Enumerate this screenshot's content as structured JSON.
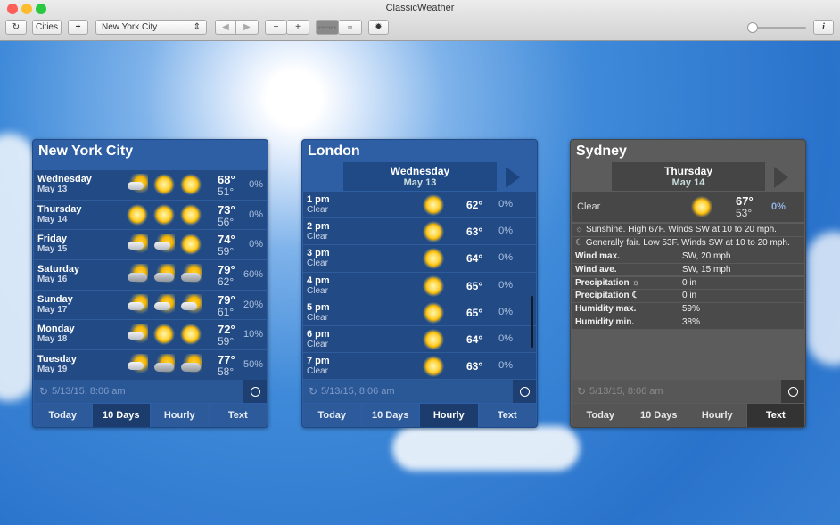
{
  "window": {
    "title": "ClassicWeather"
  },
  "toolbar": {
    "refresh_icon": "↻",
    "cities": "Cities",
    "add": "+",
    "city_select": "New York City",
    "select_arrows": "⇕",
    "back": "◀",
    "forward": "▶",
    "zoom_out": "−",
    "zoom_in": "+",
    "view_row": "▭▭▭",
    "view_grid": "▫▫",
    "settings": "✹",
    "info": "i"
  },
  "panels": {
    "nyc": {
      "title": "New York City",
      "status": "5/13/15, 8:06 am",
      "tabs": [
        "Today",
        "10 Days",
        "Hourly",
        "Text"
      ],
      "active_tab": 1,
      "days": [
        {
          "day": "Wednesday",
          "date": "May 13",
          "icons": [
            "partly-cloudy",
            "sun",
            "sun"
          ],
          "hi": "68°",
          "lo": "51°",
          "precip": "0%"
        },
        {
          "day": "Thursday",
          "date": "May 14",
          "icons": [
            "sun",
            "sun",
            "sun"
          ],
          "hi": "73°",
          "lo": "56°",
          "precip": "0%"
        },
        {
          "day": "Friday",
          "date": "May 15",
          "icons": [
            "partly-cloudy",
            "partly-cloudy",
            "sun"
          ],
          "hi": "74°",
          "lo": "59°",
          "precip": "0%"
        },
        {
          "day": "Saturday",
          "date": "May 16",
          "icons": [
            "rain",
            "rain",
            "rain"
          ],
          "hi": "79°",
          "lo": "62°",
          "precip": "60%"
        },
        {
          "day": "Sunday",
          "date": "May 17",
          "icons": [
            "partly-cloudy",
            "partly-cloudy",
            "partly-cloudy"
          ],
          "hi": "79°",
          "lo": "61°",
          "precip": "20%"
        },
        {
          "day": "Monday",
          "date": "May 18",
          "icons": [
            "partly-cloudy",
            "sun",
            "sun"
          ],
          "hi": "72°",
          "lo": "59°",
          "precip": "10%"
        },
        {
          "day": "Tuesday",
          "date": "May 19",
          "icons": [
            "partly-cloudy",
            "rain",
            "rain"
          ],
          "hi": "77°",
          "lo": "58°",
          "precip": "50%"
        }
      ]
    },
    "london": {
      "title": "London",
      "day": "Wednesday",
      "date": "May 13",
      "status": "5/13/15, 8:06 am",
      "tabs": [
        "Today",
        "10 Days",
        "Hourly",
        "Text"
      ],
      "active_tab": 2,
      "hours": [
        {
          "time": "1 pm",
          "cond": "Clear",
          "temp": "62°",
          "precip": "0%"
        },
        {
          "time": "2 pm",
          "cond": "Clear",
          "temp": "63°",
          "precip": "0%"
        },
        {
          "time": "3 pm",
          "cond": "Clear",
          "temp": "64°",
          "precip": "0%"
        },
        {
          "time": "4 pm",
          "cond": "Clear",
          "temp": "65°",
          "precip": "0%"
        },
        {
          "time": "5 pm",
          "cond": "Clear",
          "temp": "65°",
          "precip": "0%"
        },
        {
          "time": "6 pm",
          "cond": "Clear",
          "temp": "64°",
          "precip": "0%"
        },
        {
          "time": "7 pm",
          "cond": "Clear",
          "temp": "63°",
          "precip": "0%"
        }
      ]
    },
    "sydney": {
      "title": "Sydney",
      "day": "Thursday",
      "date": "May 14",
      "cond": "Clear",
      "hi": "67°",
      "lo": "53°",
      "precip": "0%",
      "status": "5/13/15, 8:06 am",
      "tabs": [
        "Today",
        "10 Days",
        "Hourly",
        "Text"
      ],
      "active_tab": 3,
      "day_text": "Sunshine. High 67F. Winds SW at 10 to 20 mph.",
      "night_text": "Generally fair. Low 53F. Winds SW at 10 to 20 mph.",
      "details": [
        {
          "label": "Wind max.",
          "value": "SW, 20 mph"
        },
        {
          "label": "Wind ave.",
          "value": "SW, 15 mph"
        },
        {
          "label": "Precipitation ☼",
          "value": "0 in"
        },
        {
          "label": "Precipitation ☾",
          "value": "0 in"
        },
        {
          "label": "Humidity max.",
          "value": "59%"
        },
        {
          "label": "Humidity min.",
          "value": "38%"
        }
      ]
    }
  }
}
